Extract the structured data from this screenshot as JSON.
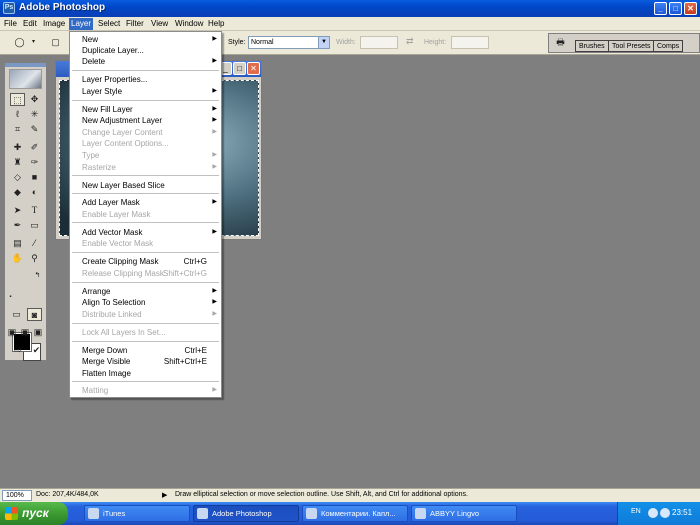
{
  "window": {
    "title": "Adobe Photoshop"
  },
  "menubar": {
    "items": [
      "File",
      "Edit",
      "Image",
      "Layer",
      "Select",
      "Filter",
      "View",
      "Window",
      "Help"
    ],
    "active_index": 3
  },
  "options": {
    "style_label": "Style:",
    "style_value": "Normal",
    "width_label": "Width:",
    "height_label": "Height:",
    "palette_tabs": [
      "Brushes",
      "Tool Presets",
      "Comps"
    ]
  },
  "layer_menu": {
    "items": [
      {
        "label": "New",
        "submenu": true
      },
      {
        "label": "Duplicate Layer..."
      },
      {
        "label": "Delete",
        "submenu": true
      },
      {
        "label": "Layer Properties..."
      },
      {
        "label": "Layer Style",
        "submenu": true
      },
      {
        "label": "New Fill Layer",
        "submenu": true
      },
      {
        "label": "New Adjustment Layer",
        "submenu": true
      },
      {
        "label": "Change Layer Content",
        "submenu": true,
        "disabled": true
      },
      {
        "label": "Layer Content Options...",
        "disabled": true
      },
      {
        "label": "Type",
        "submenu": true,
        "disabled": true
      },
      {
        "label": "Rasterize",
        "submenu": true,
        "disabled": true
      },
      {
        "label": "New Layer Based Slice"
      },
      {
        "label": "Add Layer Mask",
        "submenu": true
      },
      {
        "label": "Enable Layer Mask",
        "disabled": true
      },
      {
        "label": "Add Vector Mask",
        "submenu": true
      },
      {
        "label": "Enable Vector Mask",
        "disabled": true
      },
      {
        "label": "Create Clipping Mask",
        "shortcut": "Ctrl+G"
      },
      {
        "label": "Release Clipping Mask",
        "shortcut": "Shift+Ctrl+G",
        "disabled": true
      },
      {
        "label": "Arrange",
        "submenu": true
      },
      {
        "label": "Align To Selection",
        "submenu": true
      },
      {
        "label": "Distribute Linked",
        "submenu": true,
        "disabled": true
      },
      {
        "label": "Lock All Layers In Set...",
        "disabled": true
      },
      {
        "label": "Merge Down",
        "shortcut": "Ctrl+E"
      },
      {
        "label": "Merge Visible",
        "shortcut": "Shift+Ctrl+E"
      },
      {
        "label": "Flatten Image"
      },
      {
        "label": "Matting",
        "submenu": true,
        "disabled": true
      }
    ]
  },
  "status": {
    "zoom": "100%",
    "doc": "Doc: 207,4K/484,0K",
    "hint": "Draw elliptical selection or move selection outline.  Use Shift, Alt, and Ctrl for additional options."
  },
  "taskbar": {
    "start_label": "пуск",
    "tasks": [
      {
        "label": "iTunes"
      },
      {
        "label": "Adobe Photoshop",
        "active": true
      },
      {
        "label": "Комментарии. Капл..."
      },
      {
        "label": "ABBYY Lingvo"
      }
    ],
    "lang": "EN",
    "clock": "23:51"
  },
  "colors": {
    "title_bar": "#0a5ce0",
    "menu_highlight": "#316ac5",
    "workspace": "#7f7f7f",
    "start_button": "#3b9b32"
  }
}
